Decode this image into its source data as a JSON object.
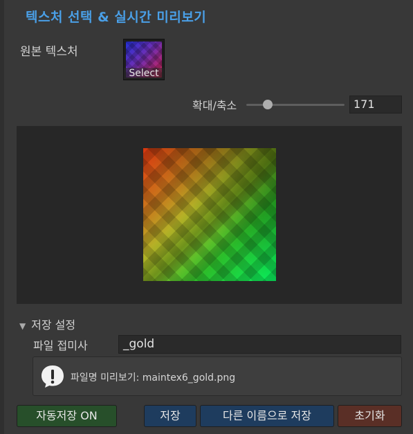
{
  "window": {
    "title": "텍스처 선택 & 실시간 미리보기"
  },
  "source_texture": {
    "label": "원본 텍스처",
    "select_label": "Select"
  },
  "zoom": {
    "label": "확대/축소",
    "value": "171",
    "slider_fraction": 0.22
  },
  "save_settings": {
    "foldout_label": "저장 설정",
    "expanded": true,
    "suffix_label": "파일 접미사",
    "suffix_value": "_gold",
    "help_text": "파일명 미리보기: maintex6_gold.png"
  },
  "buttons": {
    "auto_save": "자동저장 ON",
    "save": "저장",
    "save_as": "다른 이름으로 저장",
    "reset": "초기화"
  },
  "colors": {
    "accent": "#4aa0e8",
    "auto_save_bg": "#274f2a",
    "save_bg": "#1e3c5e",
    "reset_bg": "#5a2f26"
  }
}
